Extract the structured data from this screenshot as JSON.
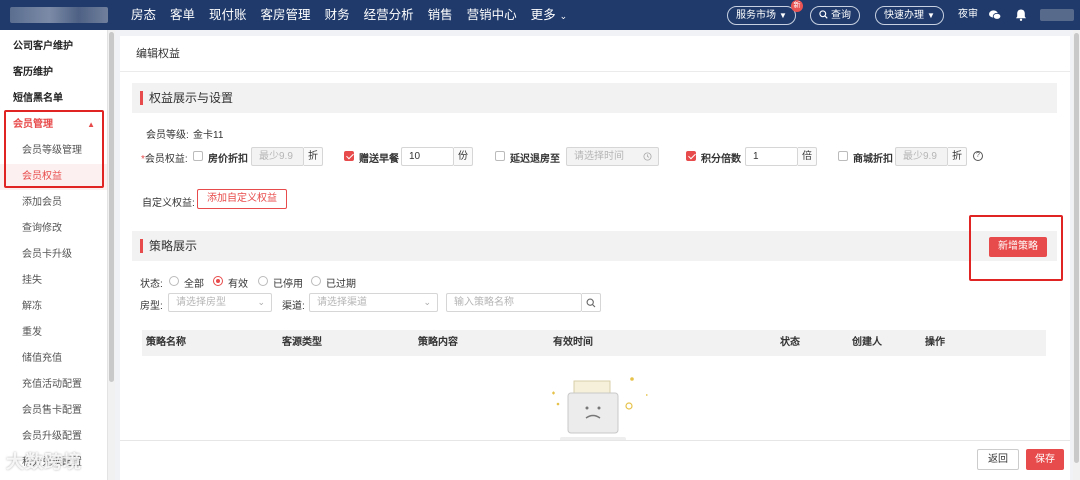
{
  "topnav": {
    "items": [
      "房态",
      "客单",
      "现付账",
      "客房管理",
      "财务",
      "经营分析",
      "销售",
      "营销中心"
    ],
    "more": "更多",
    "service_market": "服务市场",
    "new_badge": "新",
    "query": "查询",
    "quick_action": "快速办理",
    "night_audit": "夜审"
  },
  "sidebar": {
    "top_items": [
      "公司客户维护",
      "客历维护",
      "短信黑名单"
    ],
    "group": "会员管理",
    "items": [
      "会员等级管理",
      "会员权益",
      "添加会员",
      "查询修改",
      "会员卡升级",
      "挂失",
      "解冻",
      "重发",
      "储值充值",
      "充值活动配置",
      "会员售卡配置",
      "会员升级配置",
      "积分兑换配置"
    ],
    "active": "会员权益"
  },
  "page": {
    "title": "编辑权益",
    "section1": "权益展示与设置",
    "member_level_label": "会员等级:",
    "member_level_value": "金卡11",
    "rights_label": "会员权益:",
    "rights": [
      {
        "label": "房价折扣",
        "checked": false,
        "placeholder": "最少9.9",
        "unit": "折"
      },
      {
        "label": "赠送早餐",
        "checked": true,
        "value": "10",
        "unit": "份"
      },
      {
        "label": "延迟退房至",
        "checked": false,
        "placeholder": "请选择时间"
      },
      {
        "label": "积分倍数",
        "checked": true,
        "value": "1",
        "unit": "倍"
      },
      {
        "label": "商城折扣",
        "checked": false,
        "placeholder": "最少9.9",
        "unit": "折"
      }
    ],
    "custom_label": "自定义权益:",
    "add_custom": "添加自定义权益",
    "section2": "策略展示",
    "new_strategy": "新增策略",
    "status_label": "状态:",
    "status_options": [
      "全部",
      "有效",
      "已停用",
      "已过期"
    ],
    "status_selected": "有效",
    "room_type_label": "房型:",
    "room_type_placeholder": "请选择房型",
    "channel_label": "渠道:",
    "channel_placeholder": "请选择渠道",
    "name_placeholder": "输入策略名称",
    "columns": [
      "策略名称",
      "客源类型",
      "策略内容",
      "有效时间",
      "状态",
      "创建人",
      "操作"
    ]
  },
  "footer": {
    "back": "返回",
    "save": "保存",
    "watermark": "大数跨境"
  },
  "colors": {
    "brand_red": "#e84b4b",
    "nav_blue": "#1f3a6b",
    "highlight": "#e02424"
  }
}
